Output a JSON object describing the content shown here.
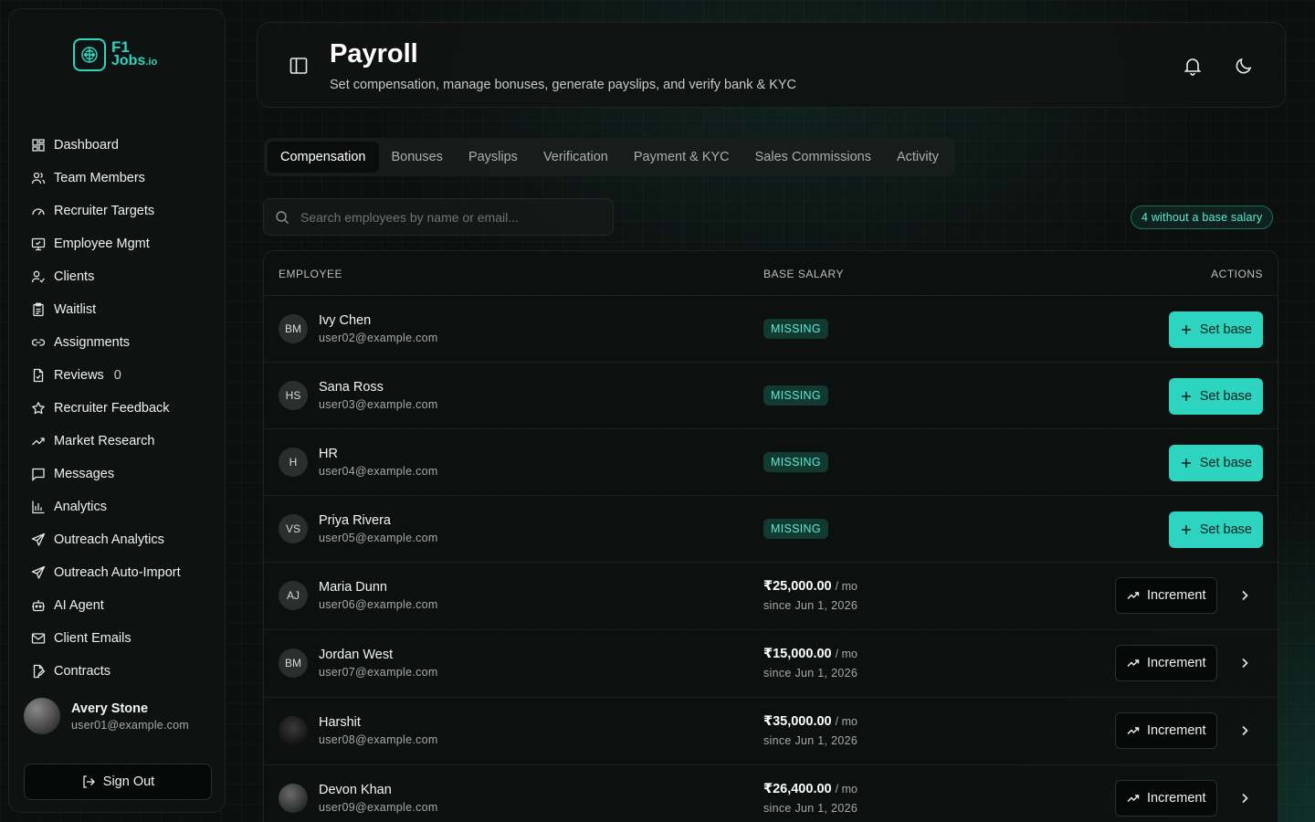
{
  "brand": {
    "line1": "F1",
    "line2": "Jobs",
    "suffix": ".io"
  },
  "sidebar": {
    "items": [
      {
        "label": "Dashboard",
        "icon": "dashboard-icon"
      },
      {
        "label": "Team Members",
        "icon": "users-icon"
      },
      {
        "label": "Recruiter Targets",
        "icon": "gauge-icon"
      },
      {
        "label": "Employee Mgmt",
        "icon": "monitor-icon"
      },
      {
        "label": "Clients",
        "icon": "user-check-icon"
      },
      {
        "label": "Waitlist",
        "icon": "clipboard-icon"
      },
      {
        "label": "Assignments",
        "icon": "link-icon"
      },
      {
        "label": "Reviews",
        "icon": "file-check-icon",
        "count": "0"
      },
      {
        "label": "Recruiter Feedback",
        "icon": "star-icon"
      },
      {
        "label": "Market Research",
        "icon": "trending-up-icon"
      },
      {
        "label": "Messages",
        "icon": "message-icon"
      },
      {
        "label": "Analytics",
        "icon": "bar-chart-icon"
      },
      {
        "label": "Outreach Analytics",
        "icon": "send-icon"
      },
      {
        "label": "Outreach Auto-Import",
        "icon": "send-icon"
      },
      {
        "label": "AI Agent",
        "icon": "bot-icon"
      },
      {
        "label": "Client Emails",
        "icon": "mail-icon"
      },
      {
        "label": "Contracts",
        "icon": "file-edit-icon"
      }
    ],
    "user": {
      "name": "Avery Stone",
      "email": "user01@example.com"
    },
    "signout_label": "Sign Out"
  },
  "header": {
    "title": "Payroll",
    "subtitle": "Set compensation, manage bonuses, generate payslips, and verify bank & KYC"
  },
  "tabs": [
    "Compensation",
    "Bonuses",
    "Payslips",
    "Verification",
    "Payment & KYC",
    "Sales Commissions",
    "Activity"
  ],
  "active_tab": "Compensation",
  "search": {
    "placeholder": "Search employees by name or email..."
  },
  "missing_badge": "4 without a base salary",
  "table": {
    "columns": {
      "employee": "EMPLOYEE",
      "base_salary": "BASE SALARY",
      "actions": "ACTIONS"
    },
    "set_base_label": "Set base",
    "increment_label": "Increment",
    "missing_label": "MISSING",
    "per_label": "/ mo",
    "rows": [
      {
        "initials": "BM",
        "name": "Ivy Chen",
        "email": "user02@example.com",
        "status": "missing"
      },
      {
        "initials": "HS",
        "name": "Sana Ross",
        "email": "user03@example.com",
        "status": "missing"
      },
      {
        "initials": "H",
        "name": "HR",
        "email": "user04@example.com",
        "status": "missing"
      },
      {
        "initials": "VS",
        "name": "Priya Rivera",
        "email": "user05@example.com",
        "status": "missing"
      },
      {
        "initials": "AJ",
        "name": "Maria Dunn",
        "email": "user06@example.com",
        "status": "set",
        "salary": "₹25,000.00",
        "since": "since Jun 1, 2026"
      },
      {
        "initials": "BM",
        "name": "Jordan West",
        "email": "user07@example.com",
        "status": "set",
        "salary": "₹15,000.00",
        "since": "since Jun 1, 2026"
      },
      {
        "initials": "",
        "name": "Harshit",
        "email": "user08@example.com",
        "status": "set",
        "salary": "₹35,000.00",
        "since": "since Jun 1, 2026",
        "avatar": "dark"
      },
      {
        "initials": "",
        "name": "Devon Khan",
        "email": "user09@example.com",
        "status": "set",
        "salary": "₹26,400.00",
        "since": "since Jun 1, 2026",
        "avatar": "photo"
      }
    ]
  },
  "colors": {
    "accent": "#2dd4bf",
    "background": "#0b0f0e"
  }
}
